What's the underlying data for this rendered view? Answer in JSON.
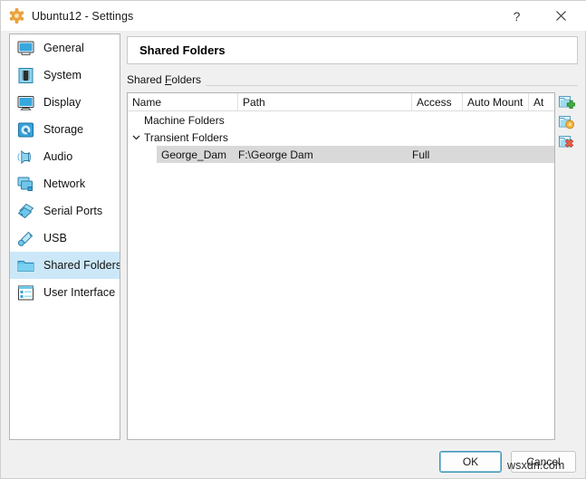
{
  "window": {
    "title": "Ubuntu12 - Settings",
    "icon": "ubuntu-logo-icon",
    "help_label": "?",
    "close_label": "✕"
  },
  "sidebar": {
    "items": [
      {
        "label": "General",
        "icon": "monitor-icon",
        "selected": false
      },
      {
        "label": "System",
        "icon": "motherboard-icon",
        "selected": false
      },
      {
        "label": "Display",
        "icon": "display-icon",
        "selected": false
      },
      {
        "label": "Storage",
        "icon": "harddisk-icon",
        "selected": false
      },
      {
        "label": "Audio",
        "icon": "speaker-icon",
        "selected": false
      },
      {
        "label": "Network",
        "icon": "network-cards-icon",
        "selected": false
      },
      {
        "label": "Serial Ports",
        "icon": "serial-ports-icon",
        "selected": false
      },
      {
        "label": "USB",
        "icon": "usb-plug-icon",
        "selected": false
      },
      {
        "label": "Shared Folders",
        "icon": "folder-icon",
        "selected": true
      },
      {
        "label": "User Interface",
        "icon": "window-icon",
        "selected": false
      }
    ]
  },
  "main": {
    "pane_title": "Shared Folders",
    "group_label_pre": "Shared ",
    "group_label_accel": "F",
    "group_label_post": "olders",
    "table": {
      "columns": [
        "Name",
        "Path",
        "Access",
        "Auto Mount",
        "At"
      ],
      "groups": [
        {
          "name": "Machine Folders",
          "expanded": false,
          "expander": "",
          "rows": []
        },
        {
          "name": "Transient Folders",
          "expanded": true,
          "expander": "chevron-down-icon",
          "rows": [
            {
              "name": "George_Dam",
              "path": "F:\\George Dam",
              "access": "Full",
              "auto_mount": "",
              "at": "",
              "selected": true
            }
          ]
        }
      ]
    },
    "toolbar": [
      {
        "name": "add-shared-folder-button",
        "icon": "folder-add-icon",
        "accent": "#3aa93a"
      },
      {
        "name": "edit-shared-folder-button",
        "icon": "folder-edit-icon",
        "accent": "#f0a830"
      },
      {
        "name": "remove-shared-folder-button",
        "icon": "folder-remove-icon",
        "accent": "#e05c3e"
      }
    ]
  },
  "footer": {
    "ok_label": "OK",
    "cancel_label": "Cancel"
  },
  "watermark": "wsxdn.com",
  "colors": {
    "dialog_bg": "#f0f0f0",
    "panel_bg": "#ffffff",
    "selection_sidebar": "#cce8f8",
    "selection_row": "#d9d9d9",
    "border": "#b4b4b4",
    "accent_focus": "#3f93b5",
    "icon_blue": "#2f9fd8"
  }
}
